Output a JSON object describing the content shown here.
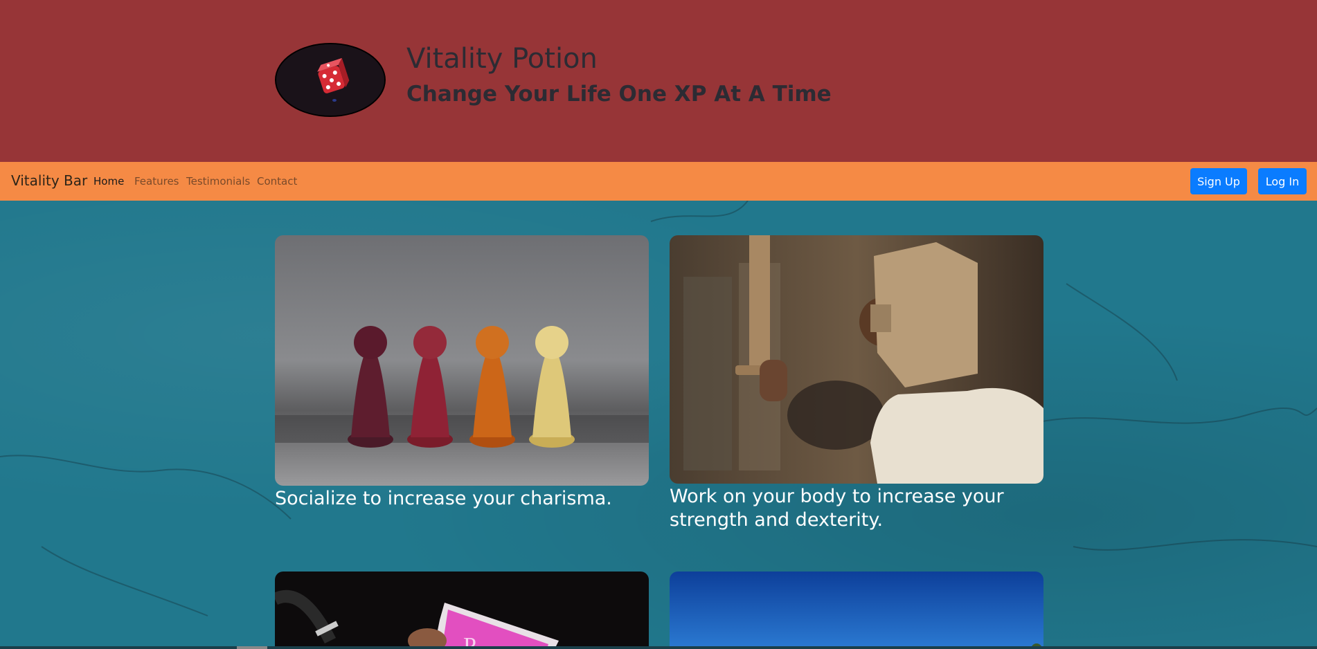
{
  "hero": {
    "title": "Vitality Potion",
    "subtitle": "Change Your Life One XP At A Time",
    "logo_icon": "dice-icon"
  },
  "navbar": {
    "brand": "Vitality Bar",
    "links": [
      "Home",
      "Features",
      "Testimonials",
      "Contact"
    ],
    "active_link": "Home",
    "signup": "Sign Up",
    "login": "Log In"
  },
  "cards": [
    {
      "caption": "Socialize to increase your charisma.",
      "image": "game-pawns-photo"
    },
    {
      "caption": "Work on your body to increase your strength and dexterity.",
      "image": "child-knight-photo"
    },
    {
      "caption": "",
      "image": "reading-magazine-photo"
    },
    {
      "caption": "",
      "image": "blue-sky-photo"
    }
  ],
  "colors": {
    "hero_bg": "#973537",
    "navbar_bg": "#f58a45",
    "button_bg": "#0a7cff",
    "content_bg": "#21788d"
  }
}
